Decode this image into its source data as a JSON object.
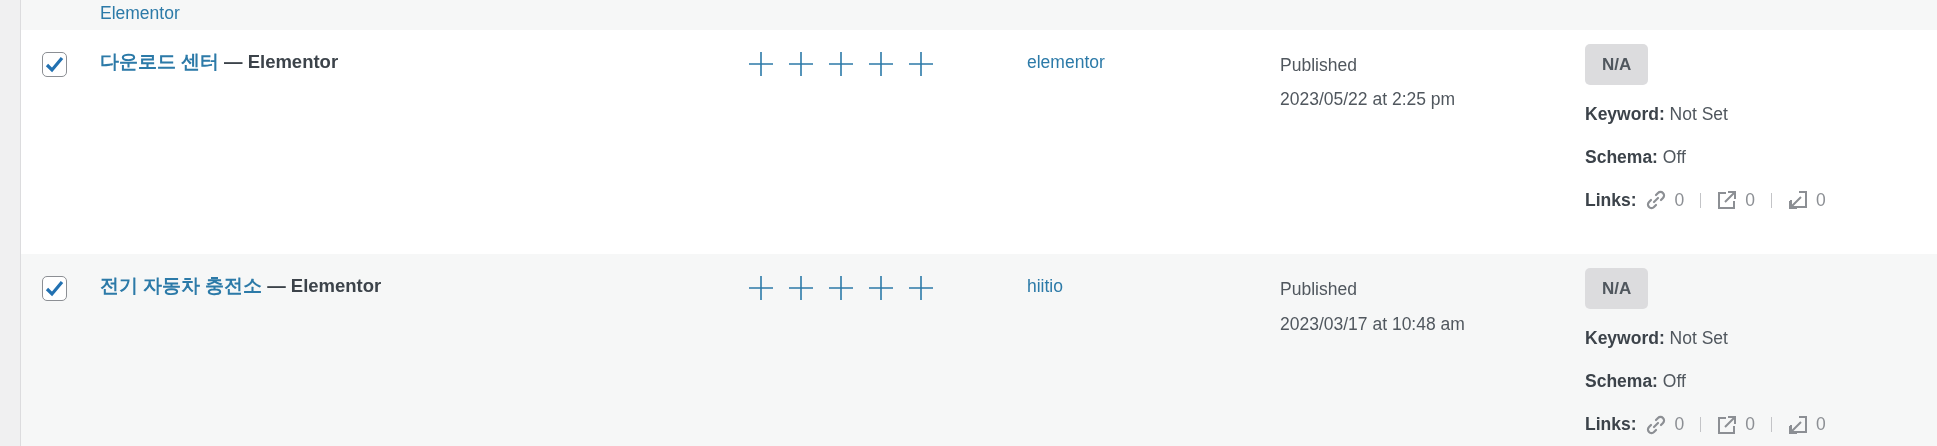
{
  "previous_row": {
    "title_tail": "Elementor"
  },
  "rows": [
    {
      "checked": true,
      "title": "다운로드 센터",
      "suffix": "— Elementor",
      "author": "elementor",
      "status": "Published",
      "date": "2023/05/22 at 2:25 pm",
      "score": "N/A",
      "keyword_label": "Keyword:",
      "keyword": "Not Set",
      "schema_label": "Schema:",
      "schema": "Off",
      "links_label": "Links:",
      "internal": "0",
      "external": "0",
      "incoming": "0"
    },
    {
      "checked": true,
      "title": "전기 자동차 충전소",
      "suffix": "— Elementor",
      "author": "hiitio",
      "status": "Published",
      "date": "2023/03/17 at 10:48 am",
      "score": "N/A",
      "keyword_label": "Keyword:",
      "keyword": "Not Set",
      "schema_label": "Schema:",
      "schema": "Off",
      "links_label": "Links:",
      "internal": "0",
      "external": "0",
      "incoming": "0"
    }
  ]
}
